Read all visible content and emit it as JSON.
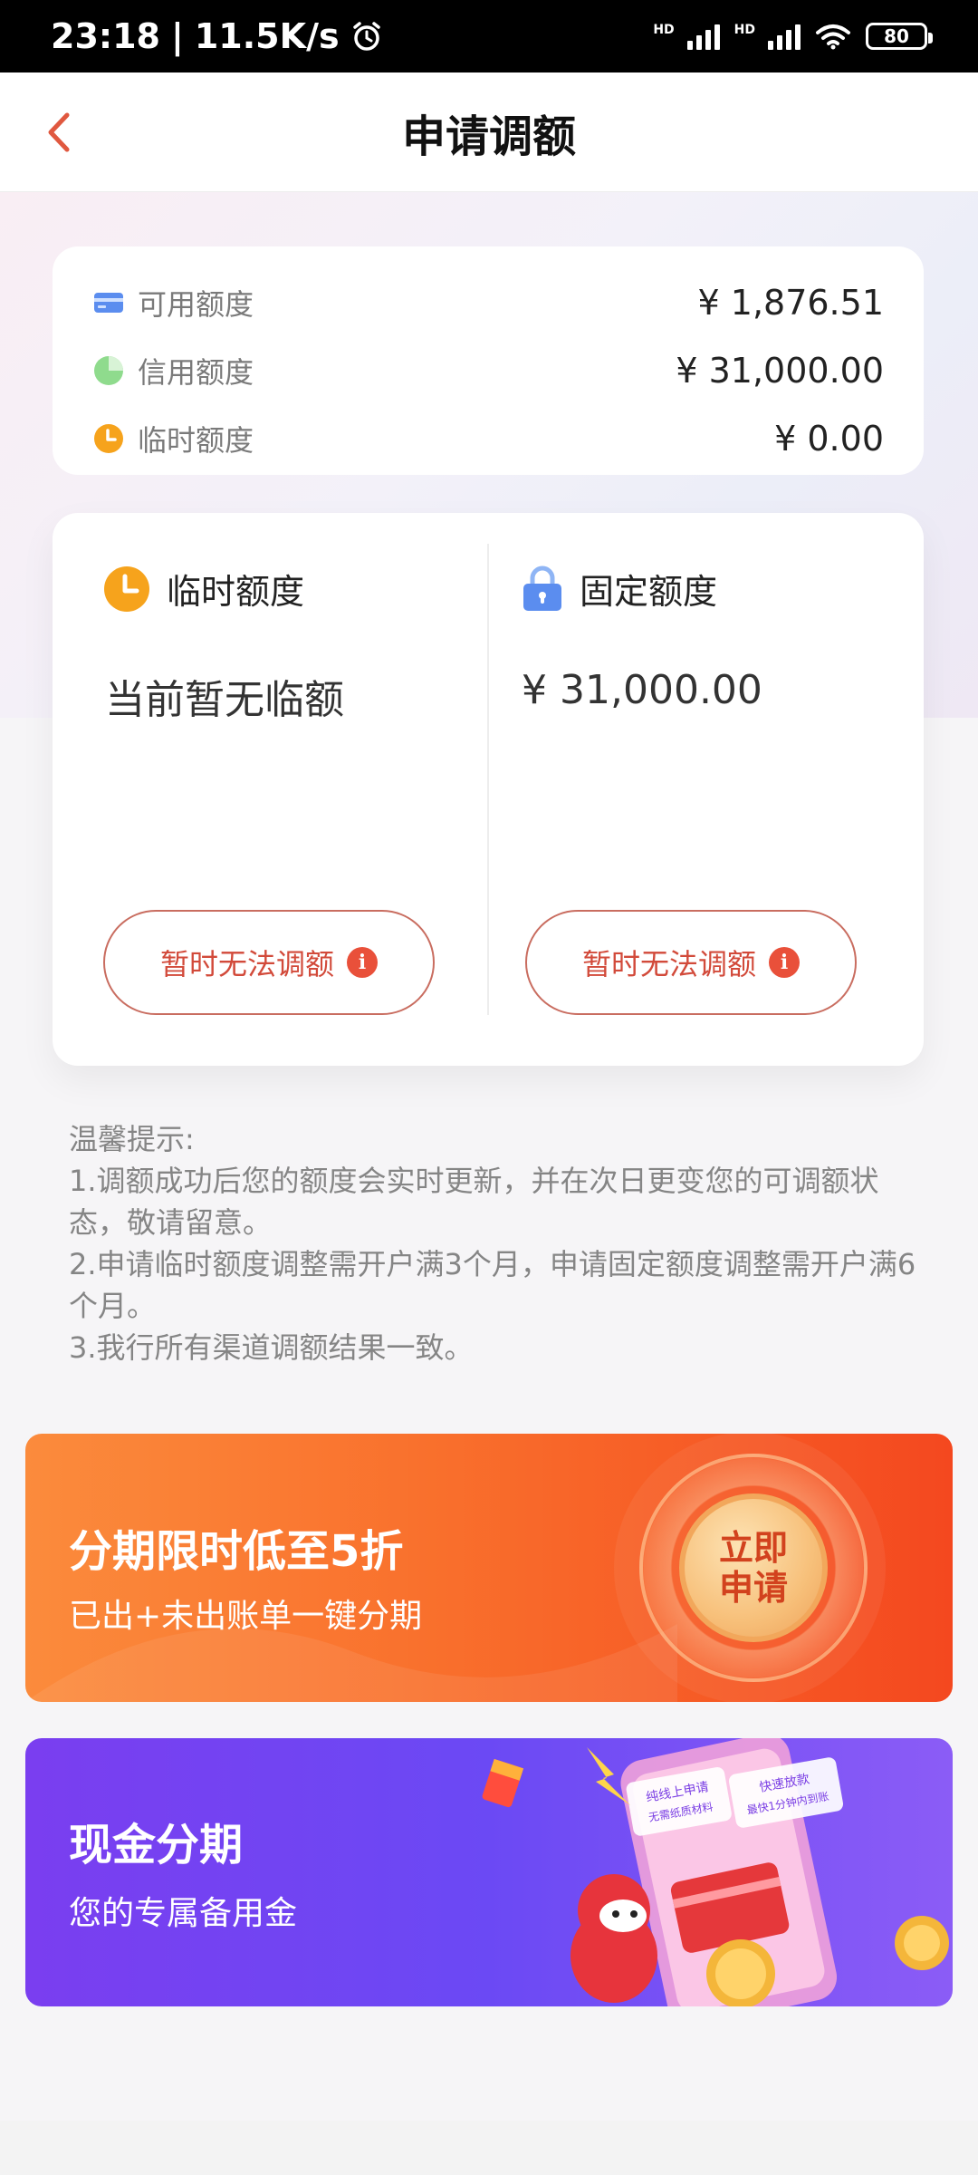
{
  "status_bar": {
    "time": "23:18",
    "net_speed": "11.5K/s",
    "hd1": "HD",
    "hd2": "HD",
    "battery": "80",
    "icons": [
      "alarm-icon",
      "signal-icon",
      "signal-icon",
      "wifi-icon",
      "battery-icon"
    ]
  },
  "nav": {
    "title": "申请调额",
    "back_icon": "chevron-left-icon"
  },
  "summary": {
    "rows": [
      {
        "label": "可用额度",
        "value": "¥ 1,876.51",
        "icon": "card-icon",
        "color": "#5b8def"
      },
      {
        "label": "信用额度",
        "value": "¥ 31,000.00",
        "icon": "pie-icon",
        "color": "#7bd17a"
      },
      {
        "label": "临时额度",
        "value": "¥ 0.00",
        "icon": "clock-icon",
        "color": "#f6a31c"
      }
    ]
  },
  "quota": {
    "temporary": {
      "title": "临时额度",
      "amount": "当前暂无临额",
      "button": "暂时无法调额",
      "icon": "clock-icon"
    },
    "fixed": {
      "title": "固定额度",
      "amount": "¥ 31,000.00",
      "button": "暂时无法调额",
      "icon": "lock-icon"
    },
    "info_glyph": "i"
  },
  "tips": {
    "heading": "温馨提示:",
    "items": [
      "1.调额成功后您的额度会实时更新，并在次日更变您的可调额状态，敬请留意。",
      "2.申请临时额度调整需开户满3个月，申请固定额度调整需开户满6个月。",
      "3.我行所有渠道调额结果一致。"
    ]
  },
  "banners": {
    "installment": {
      "title": "分期限时低至5折",
      "subtitle": "已出+未出账单一键分期",
      "apply_line1": "立即",
      "apply_line2": "申请"
    },
    "cash": {
      "title": "现金分期",
      "subtitle": "您的专属备用金",
      "tag1": "纯线上申请",
      "tag1b": "无需纸质材料",
      "tag2": "快速放款",
      "tag2b": "最快1分钟内到账"
    }
  },
  "colors": {
    "accent": "#e9503a",
    "orange_banner": "#f96f2c",
    "purple_banner": "#6b49f4"
  }
}
